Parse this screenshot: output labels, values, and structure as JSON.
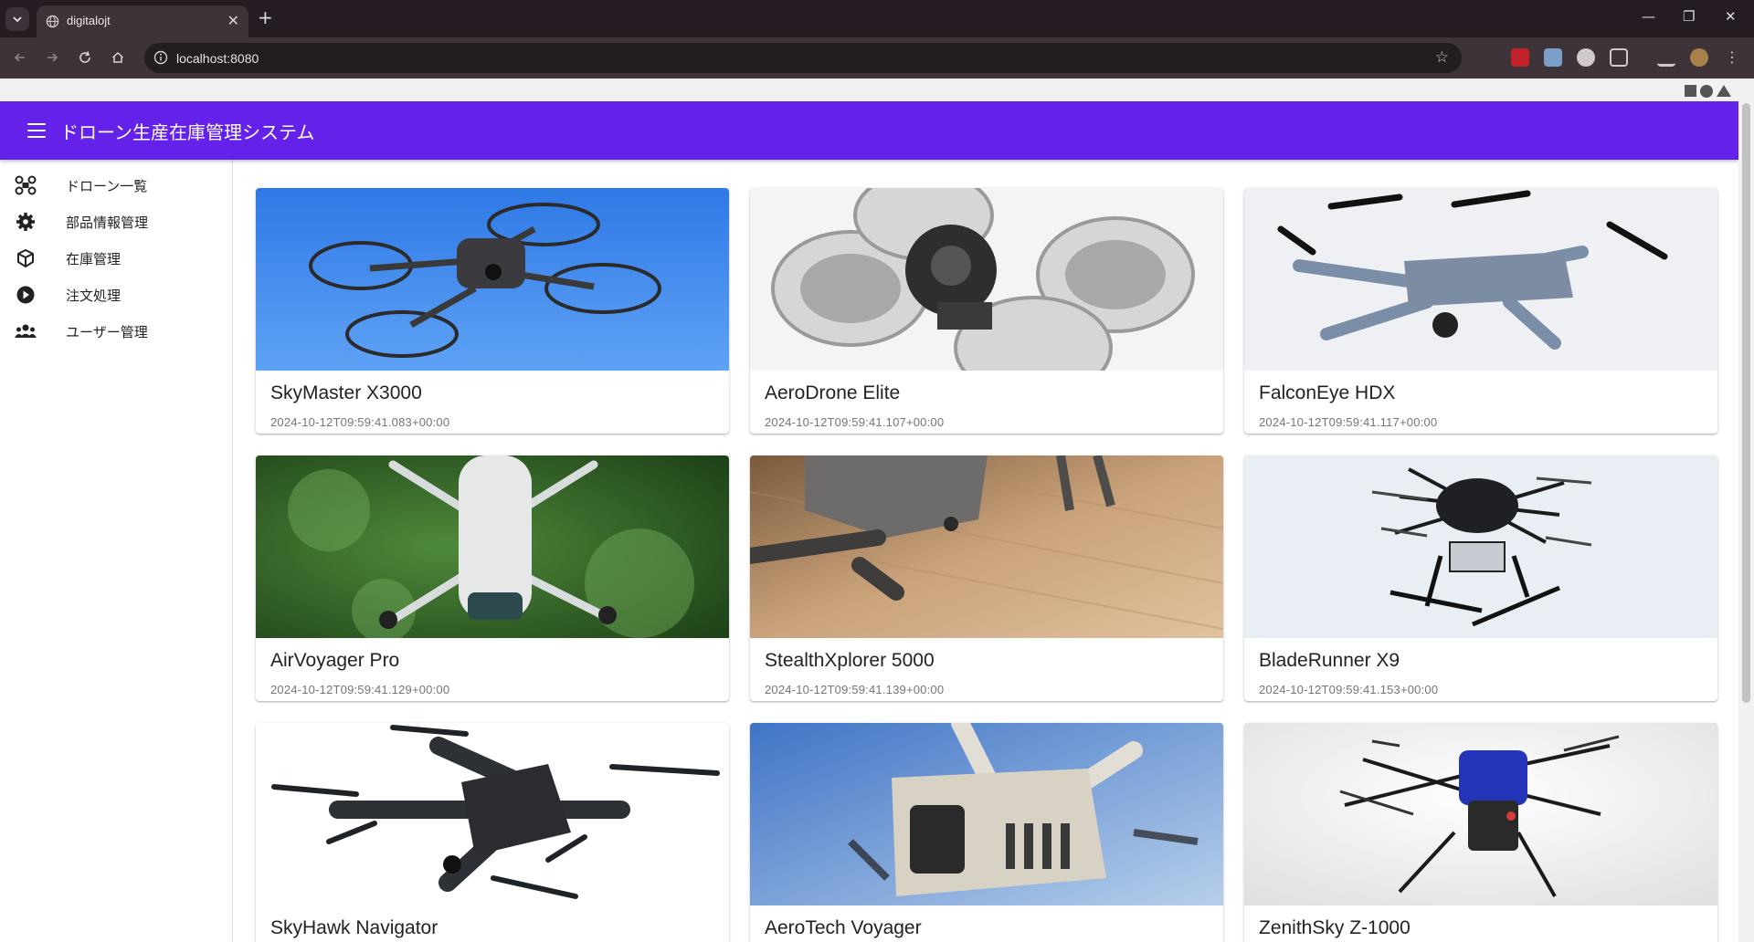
{
  "browser": {
    "tab_title": "digitalojt",
    "url": "localhost:8080"
  },
  "app": {
    "title": "ドローン生産在庫管理システム",
    "accent_color": "#6421ea"
  },
  "sidebar": {
    "items": [
      {
        "label": "ドローン一覧",
        "icon": "drone-icon"
      },
      {
        "label": "部品情報管理",
        "icon": "gear-icon"
      },
      {
        "label": "在庫管理",
        "icon": "box-icon"
      },
      {
        "label": "注文処理",
        "icon": "play-circle-icon"
      },
      {
        "label": "ユーザー管理",
        "icon": "users-icon"
      }
    ]
  },
  "drones": [
    {
      "name": "SkyMaster X3000",
      "date": "2024-10-12T09:59:41.083+00:00"
    },
    {
      "name": "AeroDrone Elite",
      "date": "2024-10-12T09:59:41.107+00:00"
    },
    {
      "name": "FalconEye HDX",
      "date": "2024-10-12T09:59:41.117+00:00"
    },
    {
      "name": "AirVoyager Pro",
      "date": "2024-10-12T09:59:41.129+00:00"
    },
    {
      "name": "StealthXplorer 5000",
      "date": "2024-10-12T09:59:41.139+00:00"
    },
    {
      "name": "BladeRunner X9",
      "date": "2024-10-12T09:59:41.153+00:00"
    },
    {
      "name": "SkyHawk Navigator",
      "date": ""
    },
    {
      "name": "AeroTech Voyager",
      "date": ""
    },
    {
      "name": "ZenithSky Z-1000",
      "date": ""
    }
  ]
}
